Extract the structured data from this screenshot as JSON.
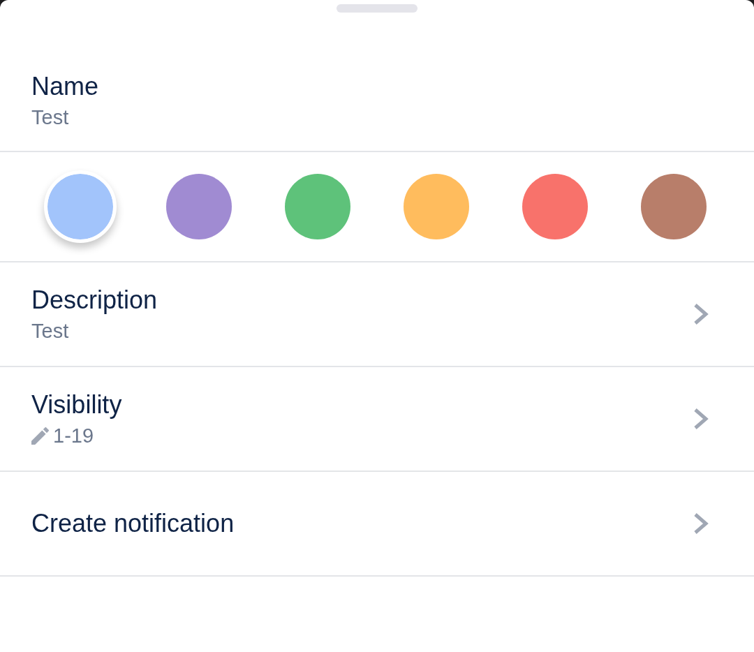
{
  "name_field": {
    "label": "Name",
    "value": "Test"
  },
  "colors": [
    {
      "color": "#a2c4fb",
      "selected": true
    },
    {
      "color": "#a08bd2",
      "selected": false
    },
    {
      "color": "#5ec27a",
      "selected": false
    },
    {
      "color": "#ffbc5d",
      "selected": false
    },
    {
      "color": "#f8726b",
      "selected": false
    },
    {
      "color": "#b87e6a",
      "selected": false
    }
  ],
  "rows": [
    {
      "kind": "text",
      "label": "Description",
      "value": "Test"
    },
    {
      "kind": "edit",
      "label": "Visibility",
      "value": "1-19"
    },
    {
      "kind": "plain",
      "label": "Create notification"
    }
  ]
}
